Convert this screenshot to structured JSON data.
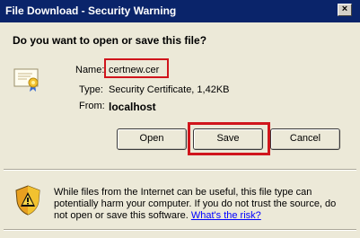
{
  "window": {
    "title": "File Download - Security Warning",
    "close_symbol": "×"
  },
  "prompt": {
    "question": "Do you want to open or save this file?"
  },
  "file": {
    "icon": "certificate-icon",
    "name_label": "Name:",
    "name_value": "certnew.cer",
    "type_label": "Type:",
    "type_value": "Security Certificate, 1,42KB",
    "from_label": "From:",
    "from_value": "localhost"
  },
  "buttons": {
    "open": "Open",
    "save": "Save",
    "cancel": "Cancel"
  },
  "warning": {
    "icon": "warning-shield-icon",
    "text": "While files from the Internet can be useful, this file type can potentially harm your computer. If you do not trust the source, do not open or save this software.",
    "link": "What's the risk?"
  },
  "colors": {
    "titlebar": "#0a246a",
    "dialog_bg": "#ece9d8",
    "highlight": "#d0151c",
    "link": "#0000ff"
  }
}
